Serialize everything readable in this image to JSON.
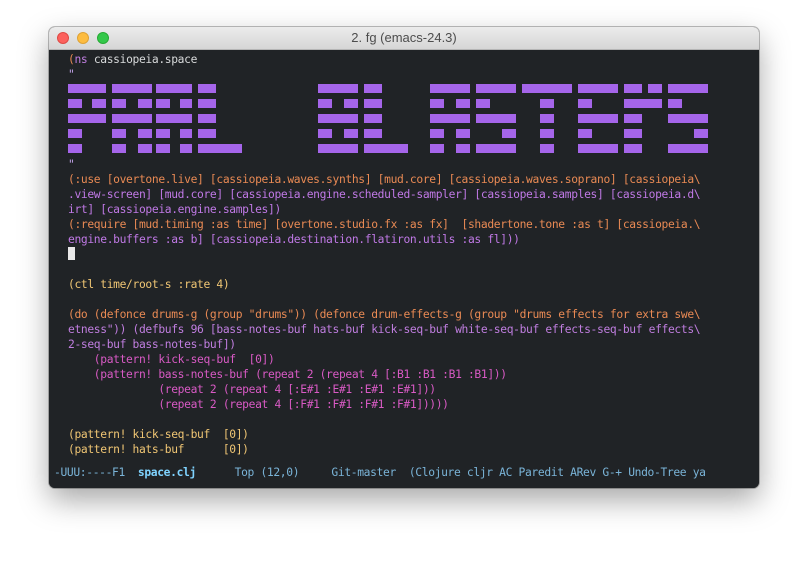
{
  "window": {
    "title": "2. fg (emacs-24.3)"
  },
  "buffer": {
    "line_ns": "(ns cassiopeia.space",
    "line_quote1": "\"",
    "line_quote2": "\"",
    "banner_text": "SPACE BLASTER",
    "line_use_1": "(:use [overtone.live] [cassiopeia.waves.synths] [mud.core] [cassiopeia.waves.soprano] [cassiopeia\\",
    "line_use_2": ".view-screen] [mud.core] [cassiopeia.engine.scheduled-sampler] [cassiopeia.samples] [cassiopeia.d\\",
    "line_use_3": "irt] [cassiopeia.engine.samples])",
    "line_req_1": "(:require [mud.timing :as time] [overtone.studio.fx :as fx]  [shadertone.tone :as t] [cassiopeia.\\",
    "line_req_2": "engine.buffers :as b] [cassiopeia.destination.flatiron.utils :as fl]))",
    "line_ctl": "(ctl time/root-s :rate 4)",
    "line_do_1": "(do (defonce drums-g (group \"drums\")) (defonce drum-effects-g (group \"drums effects for extra swe\\",
    "line_do_2": "etness\")) (defbufs 96 [bass-notes-buf hats-buf kick-seq-buf white-seq-buf effects-seq-buf effects\\",
    "line_do_3": "2-seq-buf bass-notes-buf])",
    "line_p1": "    (pattern! kick-seq-buf  [0])",
    "line_p2": "    (pattern! bass-notes-buf (repeat 2 (repeat 4 [:B1 :B1 :B1 :B1]))",
    "line_p3": "              (repeat 2 (repeat 4 [:E#1 :E#1 :E#1 :E#1]))",
    "line_p4": "              (repeat 2 (repeat 4 [:F#1 :F#1 :F#1 :F#1]))))",
    "line_k": "(pattern! kick-seq-buf  [0])",
    "line_h": "(pattern! hats-buf      [0])"
  },
  "modeline": {
    "status": "-UUU:----F1  ",
    "buffer_name": "space.clj",
    "position": "      Top (12,0)     ",
    "vc": "Git-master  ",
    "modes": "(Clojure cljr AC Paredit ARev G-+ Undo-Tree ya"
  },
  "colors": {
    "background": "#202326",
    "banner": "#a565ea",
    "paren": "#e98a54",
    "keyword": "#c07ee0",
    "modeline_text": "#7ab4d8"
  }
}
